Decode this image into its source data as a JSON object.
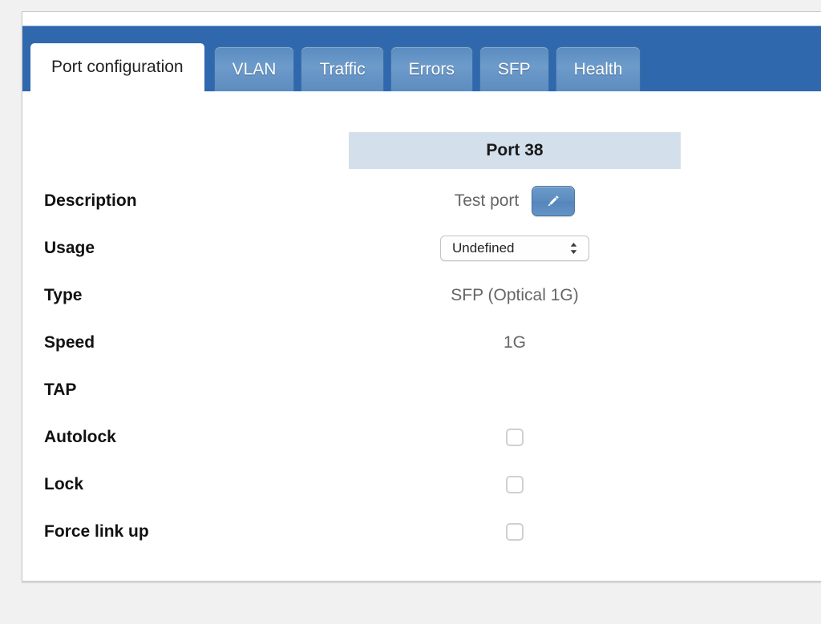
{
  "app": {
    "accent_blue": "#2f68ad",
    "tab_blue": "#6d9ccb",
    "header_band": "#d3dfeb"
  },
  "tabs": [
    {
      "label": "Port configuration",
      "active": true,
      "name": "tab-port-configuration"
    },
    {
      "label": "VLAN",
      "active": false,
      "name": "tab-vlan"
    },
    {
      "label": "Traffic",
      "active": false,
      "name": "tab-traffic"
    },
    {
      "label": "Errors",
      "active": false,
      "name": "tab-errors"
    },
    {
      "label": "SFP",
      "active": false,
      "name": "tab-sfp"
    },
    {
      "label": "Health",
      "active": false,
      "name": "tab-health"
    }
  ],
  "port": {
    "header": "Port 38"
  },
  "fields": {
    "description": {
      "label": "Description",
      "value": "Test port",
      "edit_icon": "pencil-icon"
    },
    "usage": {
      "label": "Usage",
      "selected": "Undefined",
      "options": [
        "Undefined"
      ]
    },
    "type": {
      "label": "Type",
      "value": "SFP (Optical 1G)"
    },
    "speed": {
      "label": "Speed",
      "value": "1G"
    },
    "tap": {
      "label": "TAP",
      "value": ""
    },
    "autolock": {
      "label": "Autolock",
      "checked": false
    },
    "lock": {
      "label": "Lock",
      "checked": false
    },
    "force_link_up": {
      "label": "Force link up",
      "checked": false
    }
  }
}
